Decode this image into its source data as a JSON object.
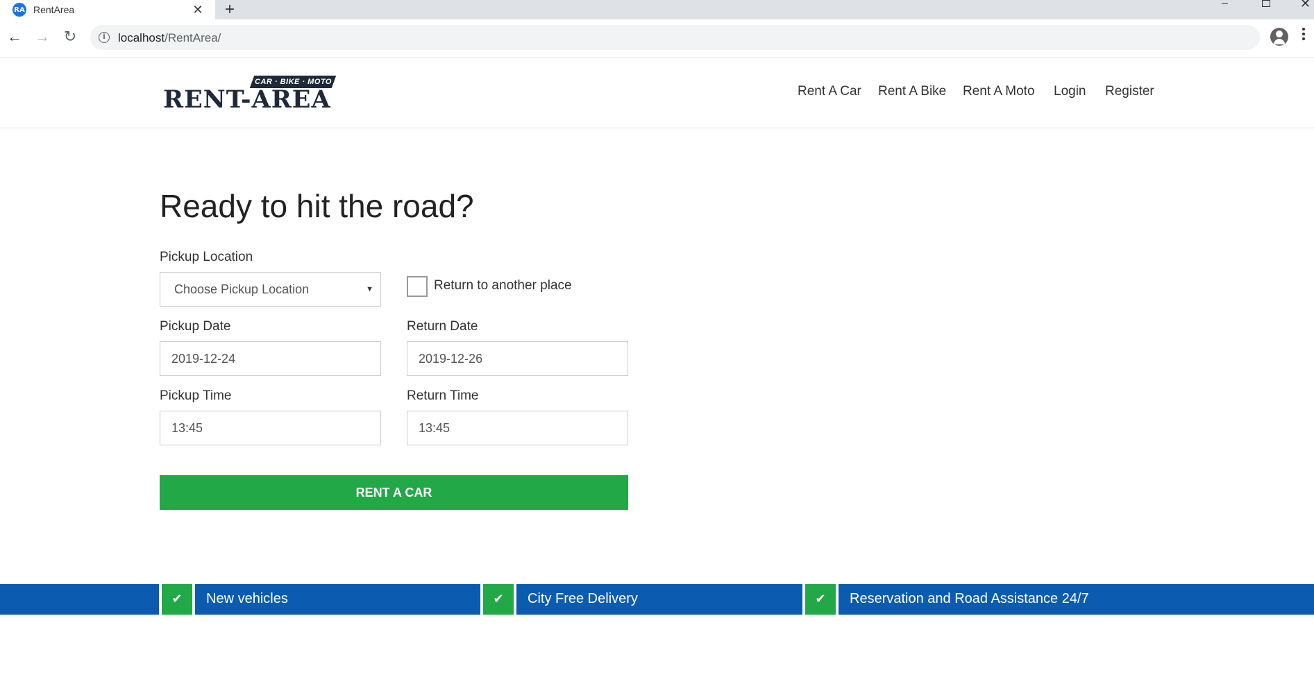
{
  "browser": {
    "tab_title": "RentArea",
    "favicon_text": "RA",
    "url_host": "localhost",
    "url_path": "/RentArea/"
  },
  "header": {
    "logo_tag": "CAR · BIKE · MOTO",
    "logo_main": "RENT-AREA",
    "nav": {
      "rent_car": "Rent A Car",
      "rent_bike": "Rent A Bike",
      "rent_moto": "Rent A Moto",
      "login": "Login",
      "register": "Register"
    }
  },
  "form": {
    "title": "Ready to hit the road?",
    "pickup_location_label": "Pickup Location",
    "pickup_location_value": "Choose Pickup Location",
    "return_other_label": "Return to another place",
    "return_other_checked": false,
    "pickup_date_label": "Pickup Date",
    "pickup_date_value": "2019-12-24",
    "return_date_label": "Return Date",
    "return_date_value": "2019-12-26",
    "pickup_time_label": "Pickup Time",
    "pickup_time_value": "13:45",
    "return_time_label": "Return Time",
    "return_time_value": "13:45",
    "submit_label": "RENT A CAR"
  },
  "features": [
    {
      "text": "New vehicles"
    },
    {
      "text": "City Free Delivery"
    },
    {
      "text": "Reservation and Road Assistance 24/7"
    }
  ],
  "colors": {
    "accent_green": "#22a846",
    "feature_blue": "#0b5cb0"
  }
}
